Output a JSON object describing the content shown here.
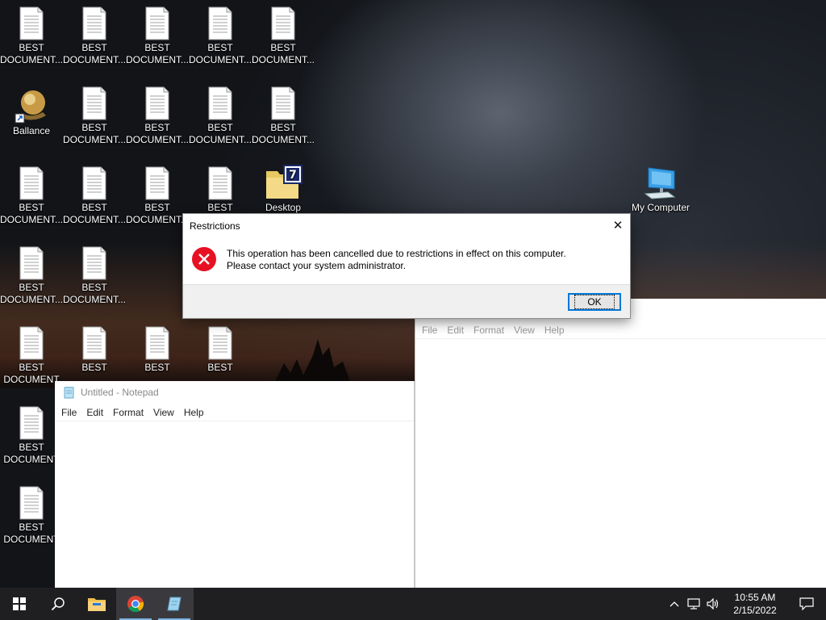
{
  "desktop": {
    "icons": [
      {
        "line1": "BEST",
        "line2": "DOCUMENT..."
      },
      {
        "line1": "BEST",
        "line2": "DOCUMENT..."
      },
      {
        "line1": "BEST",
        "line2": "DOCUMENT..."
      },
      {
        "line1": "BEST",
        "line2": "DOCUMENT..."
      },
      {
        "line1": "BEST",
        "line2": "DOCUMENT..."
      },
      {
        "line1": "Ballance",
        "line2": ""
      },
      {
        "line1": "BEST",
        "line2": "DOCUMENT..."
      },
      {
        "line1": "BEST",
        "line2": "DOCUMENT..."
      },
      {
        "line1": "BEST",
        "line2": "DOCUMENT..."
      },
      {
        "line1": "BEST",
        "line2": "DOCUMENT..."
      },
      {
        "line1": "BEST",
        "line2": "DOCUMENT..."
      },
      {
        "line1": "BEST",
        "line2": "DOCUMENT..."
      },
      {
        "line1": "BEST",
        "line2": "DOCUMENT..."
      },
      {
        "line1": "BEST",
        "line2": ""
      },
      {
        "line1": "Desktop",
        "line2": ""
      },
      {
        "line1": "BEST",
        "line2": "DOCUMENT..."
      },
      {
        "line1": "BEST",
        "line2": "DOCUMENT..."
      },
      {
        "line1": "BEST",
        "line2": "DOCUMENT"
      },
      {
        "line1": "BEST",
        "line2": ""
      },
      {
        "line1": "BEST",
        "line2": ""
      },
      {
        "line1": "BEST",
        "line2": ""
      },
      {
        "line1": "BEST",
        "line2": "DOCUMENT"
      },
      {
        "line1": "BEST",
        "line2": "DOCUMENT"
      },
      {
        "line1": "My Computer",
        "line2": ""
      }
    ]
  },
  "notepad_left": {
    "title": "Untitled - Notepad",
    "menu": [
      "File",
      "Edit",
      "Format",
      "View",
      "Help"
    ]
  },
  "notepad_right": {
    "menu": [
      "File",
      "Edit",
      "Format",
      "View",
      "Help"
    ]
  },
  "dialog": {
    "title": "Restrictions",
    "message": "This operation has been cancelled due to restrictions in effect on this computer. Please contact your system administrator.",
    "ok_label": "OK",
    "close_glyph": "✕",
    "icon": "error-icon",
    "error_color": "#e81123"
  },
  "taskbar": {
    "clock_time": "10:55 AM",
    "clock_date": "2/15/2022",
    "accent": "#7fb2e0",
    "tray_chevron": "^"
  }
}
